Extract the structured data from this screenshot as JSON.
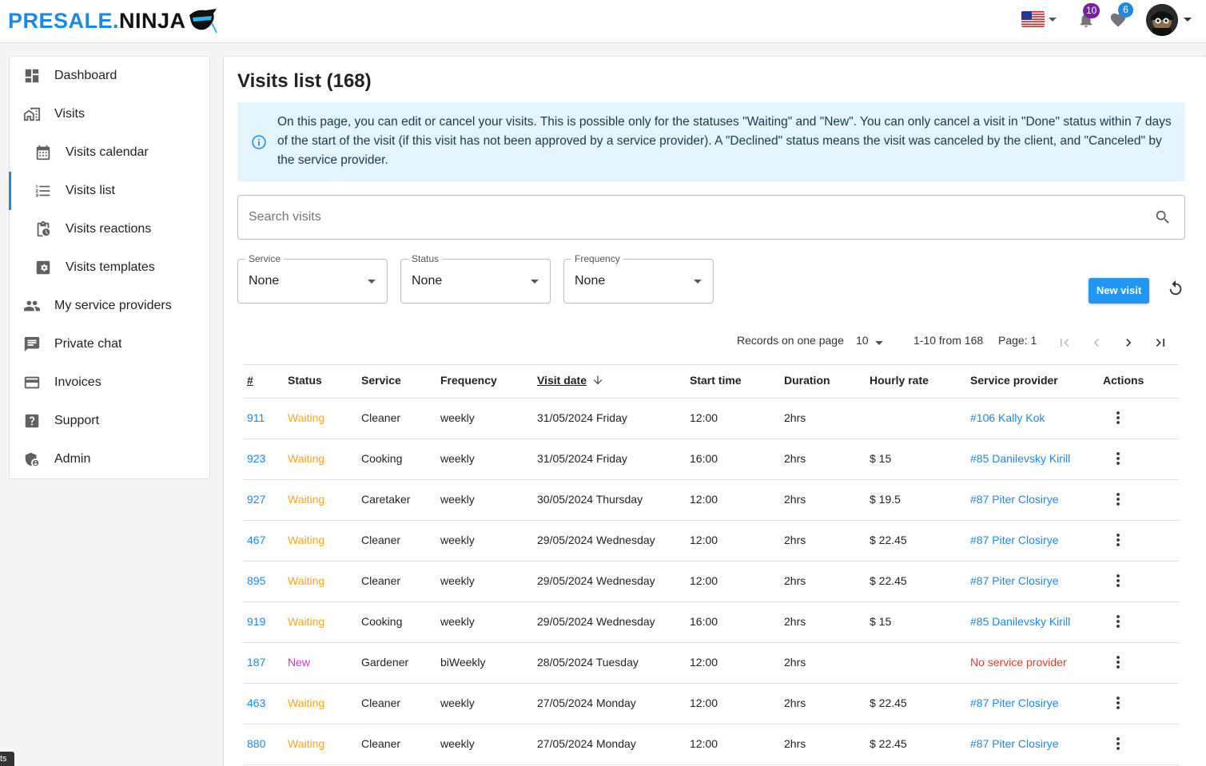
{
  "header": {
    "logo_part1": "PRESALE.",
    "logo_part2": "NINJA",
    "notifications_count": "10",
    "favorites_count": "6"
  },
  "sidebar": {
    "items": [
      {
        "label": "Dashboard",
        "icon": "dashboard-icon"
      },
      {
        "label": "Visits",
        "icon": "home-work-icon"
      },
      {
        "label": "Visits calendar",
        "icon": "calendar-icon"
      },
      {
        "label": "Visits list",
        "icon": "list-icon"
      },
      {
        "label": "Visits reactions",
        "icon": "clipboard-clock-icon"
      },
      {
        "label": "Visits templates",
        "icon": "gear-box-icon"
      },
      {
        "label": "My service providers",
        "icon": "people-icon"
      },
      {
        "label": "Private chat",
        "icon": "chat-icon"
      },
      {
        "label": "Invoices",
        "icon": "credit-card-icon"
      },
      {
        "label": "Support",
        "icon": "help-icon"
      },
      {
        "label": "Admin",
        "icon": "admin-shield-icon"
      }
    ]
  },
  "main": {
    "title": "Visits list (168)",
    "info_text": "On this page, you can edit or cancel your visits. This is possible only for the statuses \"Waiting\" and \"New\". You can only cancel a visit in \"Done\" status within 7 days of the start of the visit (if this visit has not been approved by a service provider). A \"Declined\" status means the visit was canceled by the client, and \"Canceled\" by the service provider.",
    "search_placeholder": "Search visits",
    "filters": [
      {
        "legend": "Service",
        "value": "None"
      },
      {
        "legend": "Status",
        "value": "None"
      },
      {
        "legend": "Frequency",
        "value": "None"
      }
    ],
    "new_visit_label": "New visit",
    "pagination": {
      "records_label": "Records on one page",
      "records_value": "10",
      "range": "1-10 from 168",
      "page": "Page: 1"
    },
    "table": {
      "headers": [
        "#",
        "Status",
        "Service",
        "Frequency",
        "Visit date",
        "Start time",
        "Duration",
        "Hourly rate",
        "Service provider",
        "Actions"
      ],
      "rows": [
        {
          "id": "911",
          "status": "Waiting",
          "service": "Cleaner",
          "frequency": "weekly",
          "date": "31/05/2024 Friday",
          "start": "12:00",
          "duration": "2hrs",
          "rate": "",
          "provider": "#106 Kally Kok"
        },
        {
          "id": "923",
          "status": "Waiting",
          "service": "Cooking",
          "frequency": "weekly",
          "date": "31/05/2024 Friday",
          "start": "16:00",
          "duration": "2hrs",
          "rate": "$ 15",
          "provider": "#85 Danilevsky Kirill"
        },
        {
          "id": "927",
          "status": "Waiting",
          "service": "Caretaker",
          "frequency": "weekly",
          "date": "30/05/2024 Thursday",
          "start": "12:00",
          "duration": "2hrs",
          "rate": "$ 19.5",
          "provider": "#87 Piter Closirye"
        },
        {
          "id": "467",
          "status": "Waiting",
          "service": "Cleaner",
          "frequency": "weekly",
          "date": "29/05/2024 Wednesday",
          "start": "12:00",
          "duration": "2hrs",
          "rate": "$ 22.45",
          "provider": "#87 Piter Closirye"
        },
        {
          "id": "895",
          "status": "Waiting",
          "service": "Cleaner",
          "frequency": "weekly",
          "date": "29/05/2024 Wednesday",
          "start": "12:00",
          "duration": "2hrs",
          "rate": "$ 22.45",
          "provider": "#87 Piter Closirye"
        },
        {
          "id": "919",
          "status": "Waiting",
          "service": "Cooking",
          "frequency": "weekly",
          "date": "29/05/2024 Wednesday",
          "start": "16:00",
          "duration": "2hrs",
          "rate": "$ 15",
          "provider": "#85 Danilevsky Kirill"
        },
        {
          "id": "187",
          "status": "New",
          "service": "Gardener",
          "frequency": "biWeekly",
          "date": "28/05/2024 Tuesday",
          "start": "12:00",
          "duration": "2hrs",
          "rate": "",
          "provider": "No service provider"
        },
        {
          "id": "463",
          "status": "Waiting",
          "service": "Cleaner",
          "frequency": "weekly",
          "date": "27/05/2024 Monday",
          "start": "12:00",
          "duration": "2hrs",
          "rate": "$ 22.45",
          "provider": "#87 Piter Closirye"
        },
        {
          "id": "880",
          "status": "Waiting",
          "service": "Cleaner",
          "frequency": "weekly",
          "date": "27/05/2024 Monday",
          "start": "12:00",
          "duration": "2hrs",
          "rate": "$ 22.45",
          "provider": "#87 Piter Closirye"
        }
      ]
    }
  },
  "tooltip_stub": "ts",
  "colors": {
    "accent": "#1e88e5",
    "waiting": "#f5a623",
    "new": "#c040c0",
    "no_provider": "#e53935",
    "info_bg": "#e3f4fc"
  }
}
